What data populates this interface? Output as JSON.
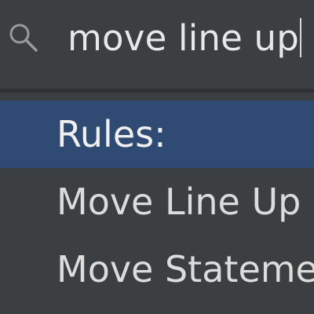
{
  "search": {
    "value": "move line up",
    "icon": "search-icon"
  },
  "results": [
    {
      "label": "Rules:"
    },
    {
      "label": "Move Line Up"
    },
    {
      "label": "Move Stateme"
    }
  ],
  "colors": {
    "background": "#3c3f41",
    "selected": "#2f4b74",
    "text": "#dcdcdc"
  }
}
